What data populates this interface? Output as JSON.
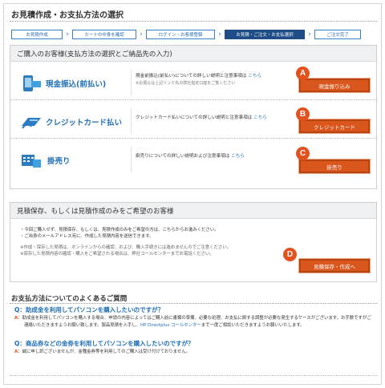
{
  "page": {
    "title": "お見積作成・お支払方法の選択"
  },
  "steps": [
    {
      "label": "お見積作成",
      "active": false
    },
    {
      "label": "カートの中身を確認",
      "active": false
    },
    {
      "label": "ログイン・お客様登録",
      "active": false
    },
    {
      "label": "お見積・ご注文・お支払選択",
      "active": true
    },
    {
      "label": "ご注文完了",
      "active": false
    }
  ],
  "purchase": {
    "heading": "ご購入のお客様(支払方法の選択とご納品先の入力)",
    "methods": [
      {
        "name": "現金振込(前払い)",
        "desc": "現金前振込(前払い)についての詳しい説明と注意事項は",
        "link": "こちら",
        "note": "※お振込は上記リンク先の弊社指定口座をご覧ください",
        "button": "現金振り込み",
        "marker": "A",
        "icon": "bank-transfer-icon"
      },
      {
        "name": "クレジットカード払い",
        "desc": "クレジットカード払いについての詳しい説明と注意事項は",
        "link": "こちら",
        "note": "",
        "button": "クレジットカード",
        "marker": "B",
        "icon": "credit-card-icon"
      },
      {
        "name": "掛売り",
        "desc": "掛売りについての詳しい説明および注意事項は",
        "link": "こちら",
        "note": "",
        "button": "掛売り",
        "marker": "C",
        "icon": "invoice-icon"
      }
    ]
  },
  "estimate": {
    "heading": "見積保存、もしくは見積作成のみをご希望のお客様",
    "lines": [
      "・今回ご購入せず、見積保存、もしくは、見積作成のみをご希望の方は、こちらからお進みください。",
      "・ご自身のメールアドレス宛に、作成した見積内容を送信できます。"
    ],
    "notes": [
      "※作成・保存した見積は、オンラインからの確認、および、購入手続きには進めませんのでご注意ください。",
      "※保存した見積内容の確認・購入をご希望される場合は、弊社コールセンターまでお電話ください。"
    ],
    "button": "見積保存・作成へ",
    "marker": "D"
  },
  "faq": {
    "title": "お支払方法についてのよくあるご質問",
    "q_label": "Q：",
    "a_label": "A：",
    "items": [
      {
        "question": "助成金を利用してパソコンを購入したいのですが？",
        "answer_pre": "助成金を利用してパソコンを購入する場合、申請の内容によってはご購入前に書類の準備、必要な処理、お支払に関する調整が必要な発生するケースがございます。お手数ですがご連絡いただきますようお願い致します。製品見積を入手し、",
        "answer_link": "HP Directplus コールセンター",
        "answer_post": "まで一度ご相談いただきますようお願いいたします。"
      },
      {
        "question": "商品券などの金券を利用してパソコンを購入したいのですが？",
        "answer_pre": "誠に申し訳ございませんが、金種金券等を利用してのご購入は受け付けておりません。",
        "answer_link": "",
        "answer_post": ""
      }
    ]
  },
  "colors": {
    "accent_orange": "#d9561c",
    "marker_orange": "#e2511e",
    "link_blue": "#1f6fb5",
    "step_active": "#1d4c86"
  }
}
